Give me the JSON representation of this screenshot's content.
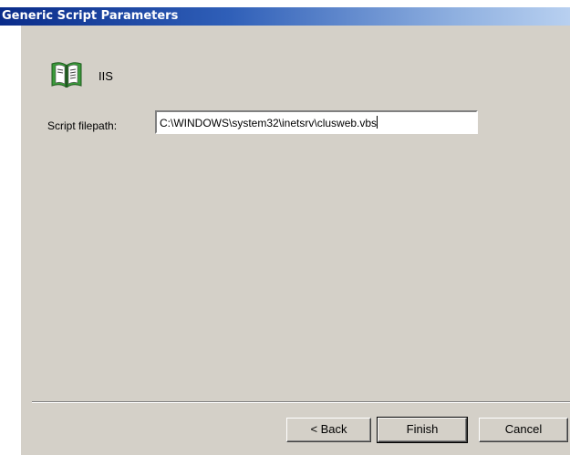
{
  "window": {
    "title": "Generic Script Parameters"
  },
  "resource": {
    "name": "IIS",
    "icon": "book-icon"
  },
  "script_path": {
    "label": "Script filepath:",
    "value": "C:\\WINDOWS\\system32\\inetsrv\\clusweb.vbs"
  },
  "buttons": {
    "back": "< Back",
    "finish": "Finish",
    "cancel": "Cancel"
  },
  "colors": {
    "titlebar_start": "#0a2c8a",
    "titlebar_end": "#b8d0f0",
    "dialog_face": "#d4d0c8"
  }
}
